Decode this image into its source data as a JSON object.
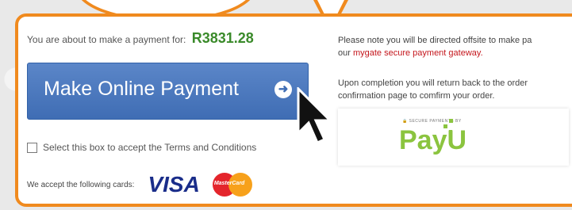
{
  "payment": {
    "intro": "You are about to make a payment for:",
    "amount": "R3831.28",
    "button_label": "Make Online Payment",
    "terms_label": "Select this box to accept the Terms and Conditions",
    "cards_label": "We accept the following cards:",
    "cards": [
      "VISA",
      "MasterCard"
    ]
  },
  "notice": {
    "line1": "Please note you will be directed offsite to make pa",
    "line2_prefix": "our ",
    "gateway_link": "mygate secure payment gateway.",
    "line3": "Upon completion you will return back to the order",
    "line4": "confirmation page to comfirm your order."
  },
  "payu": {
    "secure_label": "SECURE PAYMENTS BY",
    "logo_text": "PayU"
  },
  "colors": {
    "accent": "#f08a1e",
    "amount": "#3a8a2a",
    "button": "#4a78bd",
    "link": "#c4161c",
    "payu": "#8bc43f"
  }
}
